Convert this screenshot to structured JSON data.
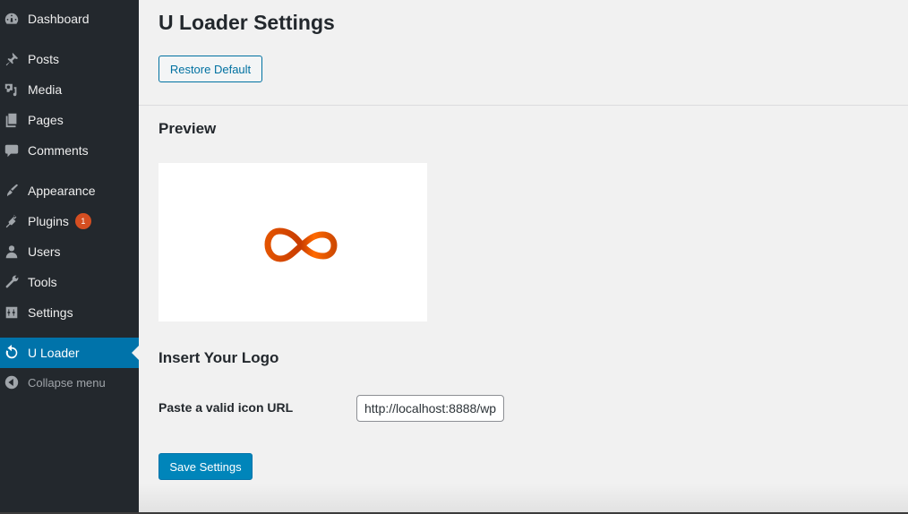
{
  "sidebar": {
    "items": [
      {
        "label": "Dashboard",
        "icon": "dashboard-icon"
      },
      {
        "label": "Posts",
        "icon": "pushpin-icon"
      },
      {
        "label": "Media",
        "icon": "media-icon"
      },
      {
        "label": "Pages",
        "icon": "pages-icon"
      },
      {
        "label": "Comments",
        "icon": "comment-icon"
      },
      {
        "label": "Appearance",
        "icon": "paintbrush-icon"
      },
      {
        "label": "Plugins",
        "icon": "plug-icon",
        "badge": "1"
      },
      {
        "label": "Users",
        "icon": "user-icon"
      },
      {
        "label": "Tools",
        "icon": "wrench-icon"
      },
      {
        "label": "Settings",
        "icon": "sliders-icon"
      },
      {
        "label": "U Loader",
        "icon": "reload-icon",
        "active": true
      }
    ],
    "collapse_label": "Collapse menu"
  },
  "page": {
    "title": "U Loader Settings",
    "restore_button": "Restore Default",
    "preview_heading": "Preview",
    "preview_icon": "infinity-loader-icon",
    "logo_heading": "Insert Your Logo",
    "url_label": "Paste a valid icon URL",
    "url_value": "http://localhost:8888/wp",
    "save_button": "Save Settings"
  },
  "colors": {
    "sidebar_bg": "#23282d",
    "active_bg": "#0073aa",
    "primary_button": "#0085ba",
    "badge": "#d54e21",
    "loader_orange": "#e85d04"
  }
}
